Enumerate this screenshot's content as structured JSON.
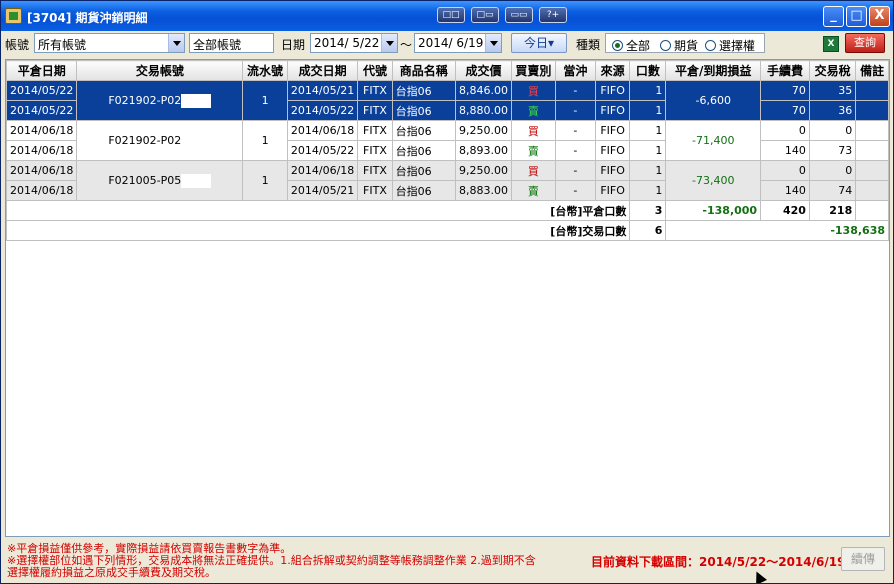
{
  "window": {
    "title": "[3704] 期貨沖銷明細",
    "toolbar_mini": [
      "□□",
      "□▭",
      "▭▭",
      "?+"
    ],
    "controls": {
      "minimize": "_",
      "maximize": "□",
      "close": "X"
    }
  },
  "toolbar": {
    "account_label": "帳號",
    "account_value": "所有帳號",
    "account_name": "全部帳號",
    "date_label": "日期",
    "date_from": "2014/ 5/22",
    "date_sep": "～",
    "date_to": "2014/ 6/19",
    "today_button": "今日▾",
    "type_label": "種類",
    "type_options": [
      "全部",
      "期貨",
      "選擇權"
    ],
    "type_selected": "全部",
    "excel_icon": "excel-icon",
    "query_button": "查詢"
  },
  "table": {
    "headers": [
      "平倉日期",
      "交易帳號",
      "流水號",
      "成交日期",
      "代號",
      "商品名稱",
      "成交價",
      "買賣別",
      "當沖",
      "來源",
      "口數",
      "平倉/到期損益",
      "手續費",
      "交易稅",
      "備註"
    ],
    "groups": [
      {
        "account": "F021902-P02",
        "serial": "1",
        "pnl": "-6,600",
        "style": "sel",
        "rows": [
          {
            "close_date": "2014/05/22",
            "trade_date": "2014/05/21",
            "code": "FITX",
            "product": "台指06",
            "price": "8,846.00",
            "side": "買",
            "day_trade": "-",
            "source": "FIFO",
            "qty": "1",
            "fee": "70",
            "tax": "35",
            "note": ""
          },
          {
            "close_date": "2014/05/22",
            "trade_date": "2014/05/22",
            "code": "FITX",
            "product": "台指06",
            "price": "8,880.00",
            "side": "賣",
            "day_trade": "-",
            "source": "FIFO",
            "qty": "1",
            "fee": "70",
            "tax": "36",
            "note": ""
          }
        ]
      },
      {
        "account": "F021902-P02",
        "serial": "1",
        "pnl": "-71,400",
        "style": "white",
        "rows": [
          {
            "close_date": "2014/06/18",
            "trade_date": "2014/06/18",
            "code": "FITX",
            "product": "台指06",
            "price": "9,250.00",
            "side": "買",
            "day_trade": "-",
            "source": "FIFO",
            "qty": "1",
            "fee": "0",
            "tax": "0",
            "note": ""
          },
          {
            "close_date": "2014/06/18",
            "trade_date": "2014/05/22",
            "code": "FITX",
            "product": "台指06",
            "price": "8,893.00",
            "side": "賣",
            "day_trade": "-",
            "source": "FIFO",
            "qty": "1",
            "fee": "140",
            "tax": "73",
            "note": ""
          }
        ]
      },
      {
        "account": "F021005-P05",
        "serial": "1",
        "pnl": "-73,400",
        "style": "gray",
        "rows": [
          {
            "close_date": "2014/06/18",
            "trade_date": "2014/06/18",
            "code": "FITX",
            "product": "台指06",
            "price": "9,250.00",
            "side": "買",
            "day_trade": "-",
            "source": "FIFO",
            "qty": "1",
            "fee": "0",
            "tax": "0",
            "note": ""
          },
          {
            "close_date": "2014/06/18",
            "trade_date": "2014/05/21",
            "code": "FITX",
            "product": "台指06",
            "price": "8,883.00",
            "side": "賣",
            "day_trade": "-",
            "source": "FIFO",
            "qty": "1",
            "fee": "140",
            "tax": "74",
            "note": ""
          }
        ]
      }
    ],
    "summary": {
      "close_label": "[台幣]平倉口數",
      "close_qty": "3",
      "close_pnl": "-138,000",
      "close_fee": "420",
      "close_tax": "218",
      "trade_label": "[台幣]交易口數",
      "trade_qty": "6",
      "trade_total": "-138,638"
    }
  },
  "footer": {
    "note1": "※平倉損益僅供參考，實際損益請依買賣報告書數字為準。",
    "note2": "※選擇權部位如遇下列情形，交易成本將無法正確提供。1.組合拆解或契約調整等帳務調整作業 2.過到期不含",
    "note3": "選擇權履約損益之原成交手續費及期交稅。",
    "range_text": "目前資料下載區間：2014/5/22～2014/6/19",
    "next_button": "續傳"
  },
  "colors": {
    "selected_row": "#0a3f9a",
    "buy": "#c00000",
    "sell": "#007000",
    "warning": "#d40000"
  }
}
